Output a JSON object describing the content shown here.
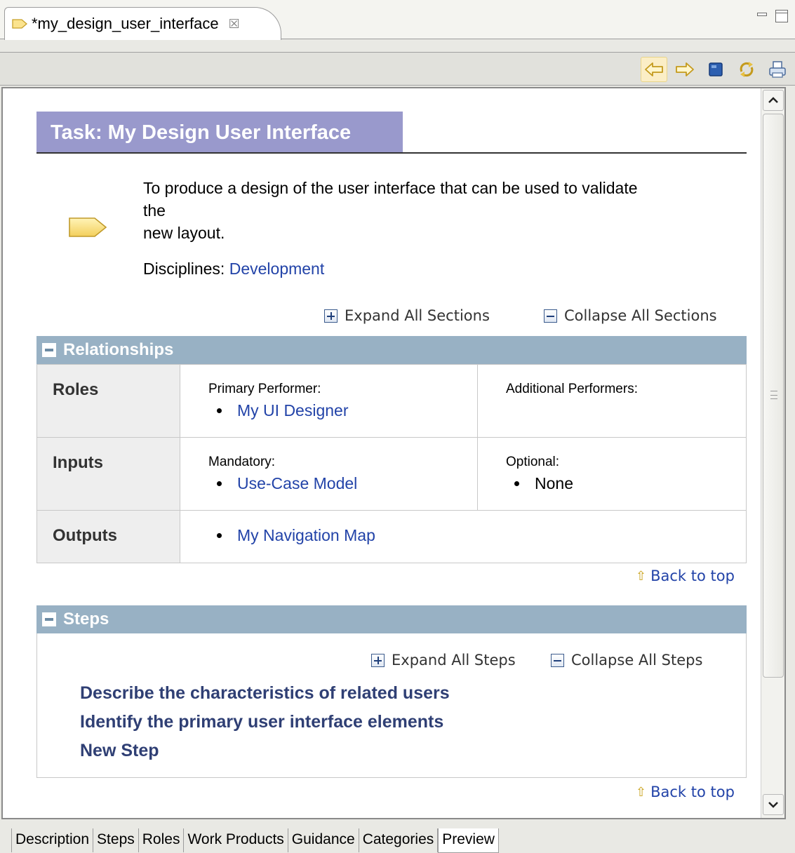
{
  "editor": {
    "tab_title": "*my_design_user_interface",
    "close_glyph": "☒"
  },
  "toolbar": {
    "buttons": [
      "back-icon",
      "forward-icon",
      "stop-icon",
      "refresh-icon",
      "print-icon"
    ]
  },
  "task": {
    "title": "Task: My Design User Interface",
    "brief_line1": "To produce a design of the user interface that can be used to validate",
    "brief_line2": "the",
    "brief_line3": "new layout.",
    "disciplines_label": "Disciplines:",
    "discipline_link": "Development"
  },
  "sections_controls": {
    "expand_all": "Expand All Sections",
    "collapse_all": "Collapse All Sections"
  },
  "relationships": {
    "header": "Relationships",
    "roles_label": "Roles",
    "primary_performer_label": "Primary Performer:",
    "primary_performer": "My UI Designer",
    "additional_performers_label": "Additional Performers:",
    "inputs_label": "Inputs",
    "mandatory_label": "Mandatory:",
    "mandatory_item": "Use-Case Model",
    "optional_label": "Optional:",
    "optional_item": "None",
    "outputs_label": "Outputs",
    "output_item": "My Navigation Map"
  },
  "back_to_top": "Back to top",
  "steps": {
    "header": "Steps",
    "expand_all": "Expand All Steps",
    "collapse_all": "Collapse All Steps",
    "items": [
      "Describe the characteristics of related users",
      "Identify the primary user interface elements",
      "New Step"
    ]
  },
  "bottom_tabs": [
    "Description",
    "Steps",
    "Roles",
    "Work Products",
    "Guidance",
    "Categories",
    "Preview"
  ],
  "selected_tab": "Preview",
  "colors": {
    "title_bar": "#9999cc",
    "section_header": "#98b1c4",
    "link": "#2243a8",
    "step_title": "#2f3f74"
  }
}
